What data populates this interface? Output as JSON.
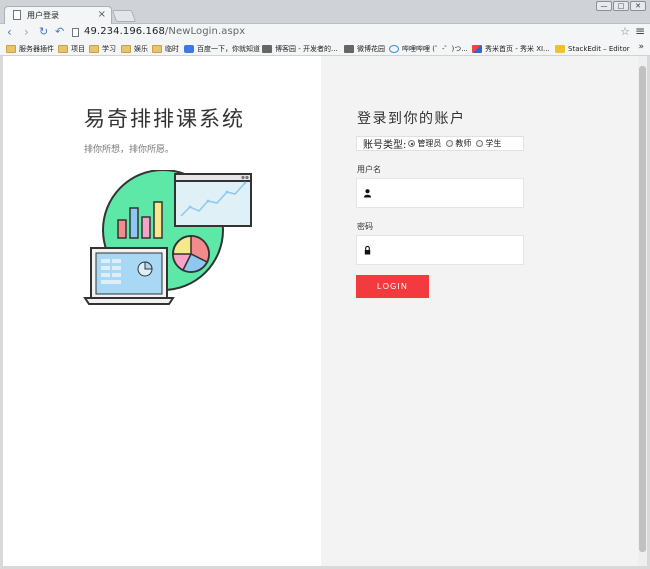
{
  "browser": {
    "tab_title": "用户登录",
    "tab_close": "×",
    "url_host": "49.234.196.168",
    "url_path": "/NewLogin.aspx",
    "window_buttons": [
      "—",
      "□",
      "✕"
    ],
    "bookmarks": [
      {
        "label": "服务器插件",
        "icon": "folder-icon"
      },
      {
        "label": "项目",
        "icon": "folder-icon"
      },
      {
        "label": "学习",
        "icon": "folder-icon"
      },
      {
        "label": "娱乐",
        "icon": "folder-icon"
      },
      {
        "label": "临时",
        "icon": "folder-icon"
      },
      {
        "label": "百度一下，你就知道",
        "icon": "baidu-icon"
      },
      {
        "label": "博客园 - 开发者的...",
        "icon": "cnblogs-icon"
      },
      {
        "label": "微博花园",
        "icon": "weibo-icon"
      },
      {
        "label": "哔哩哔哩 (゜-゜)つ...",
        "icon": "bilibili-icon"
      },
      {
        "label": "秀米首页 - 秀米 XI...",
        "icon": "xiumi-icon"
      },
      {
        "label": "StackEdit – Editor",
        "icon": "stackedit-icon"
      }
    ],
    "bookmarks_more": "»"
  },
  "left": {
    "title": "易奇排排课系统",
    "subtitle": "排你所想，排你所愿。"
  },
  "login": {
    "title": "登录到你的账户",
    "account_type_label": "账号类型:",
    "account_types": [
      "管理员",
      "教师",
      "学生"
    ],
    "selected_account_type": "管理员",
    "username_label": "用户名",
    "username_value": "",
    "password_label": "密码",
    "password_value": "",
    "button_label": "LOGIN"
  },
  "colors": {
    "accent": "#f33b3f",
    "illustration_circle": "#5ee8a8",
    "right_panel_bg": "#f3f3f3"
  }
}
